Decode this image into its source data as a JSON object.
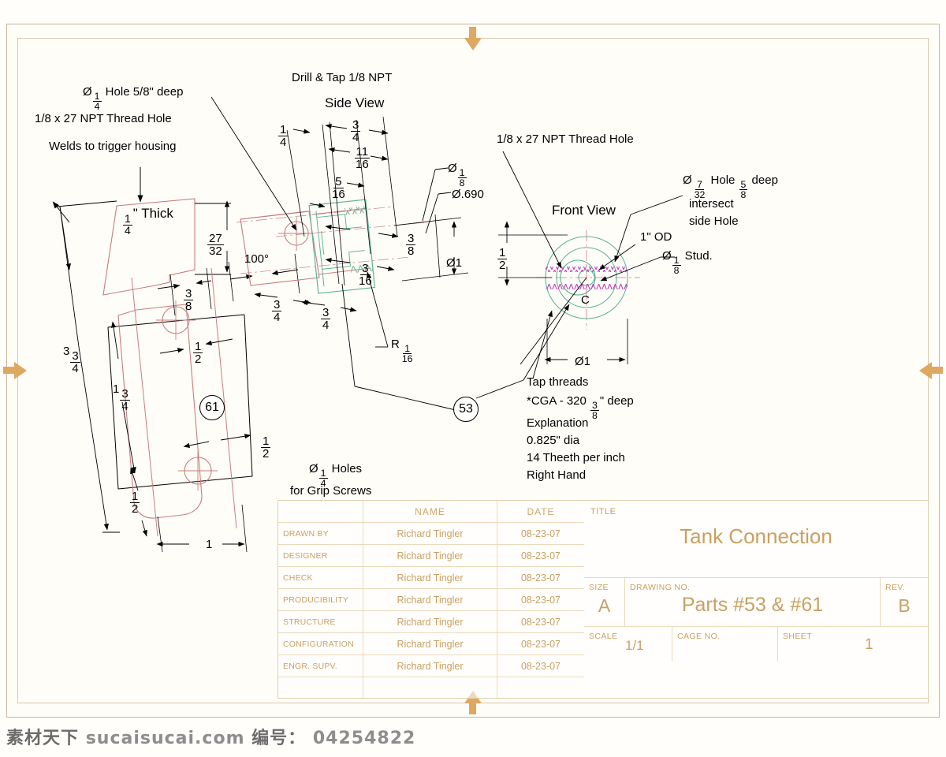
{
  "sheet": {
    "background": "#fffefb",
    "frame_color": "#c8b79a"
  },
  "views": {
    "side_view_label": "Side View",
    "front_view_label": "Front View"
  },
  "notes": {
    "drill_tap": "Drill & Tap 1/8 NPT",
    "hole_deep_prefix": "Ø",
    "hole_deep_num": "1",
    "hole_deep_den": "4",
    "hole_deep_suffix": " Hole 5/8\" deep",
    "npt_thread_hole_left": "1/8 x 27 NPT Thread Hole",
    "welds": "Welds to trigger housing",
    "npt_thread_hole_right": "1/8 x 27 NPT Thread Hole",
    "thick_num": "1",
    "thick_den": "4",
    "thick_suffix": "\" Thick",
    "angle_100": "100°",
    "dia_690": "Ø.690",
    "one_inch_od": "1\" OD",
    "stud_prefix": "Ø",
    "stud_num": "1",
    "stud_den": "8",
    "stud_suffix": " Stud.",
    "hole732_prefix": "Ø",
    "hole732_num": "7",
    "hole732_den": "32",
    "hole732_mid": " Hole ",
    "hole732_num2": "5",
    "hole732_den2": "8",
    "hole732_suffix": " deep",
    "intersect": "intersect",
    "side_hole": "side Hole",
    "center_mark": "C",
    "tap_threads": "Tap threads",
    "cga_pre": "*CGA - 320 ",
    "cga_num": "3",
    "cga_den": "8",
    "cga_post": "\" deep",
    "explanation": "Explanation",
    "dia_0825": "0.825\" dia",
    "teeth": "14 Theeth per inch",
    "right_hand": "Right Hand",
    "grip_prefix": "Ø",
    "grip_num": "1",
    "grip_den": "4",
    "grip_suffix": " Holes",
    "grip_line2": "for Grip Screws",
    "radius_prefix": "R",
    "radius_num": "1",
    "radius_den": "16"
  },
  "dimensions": {
    "d_1_4": {
      "num": "1",
      "den": "4"
    },
    "d_3_4_top": {
      "num": "3",
      "den": "4"
    },
    "d_11_16": {
      "num": "11",
      "den": "16"
    },
    "d_5_16": {
      "num": "5",
      "den": "16"
    },
    "d_3_8_side": {
      "num": "3",
      "den": "8"
    },
    "d_3_16": {
      "num": "3",
      "den": "16"
    },
    "d_3_4_a": {
      "num": "3",
      "den": "4"
    },
    "d_3_4_b": {
      "num": "3",
      "den": "4"
    },
    "d_27_32": {
      "num": "27",
      "den": "32"
    },
    "d_3_8_left": {
      "num": "3",
      "den": "8"
    },
    "d_dia_1_8": {
      "prefix": "Ø",
      "num": "1",
      "den": "8"
    },
    "d_dia_1": "Ø1",
    "d_dia_1_front": "Ø1",
    "d_1_2_front": {
      "num": "1",
      "den": "2"
    },
    "d_3_3_4": {
      "whole": "3",
      "num": "3",
      "den": "4"
    },
    "d_1_3_4": {
      "whole": "1",
      "num": "3",
      "den": "4"
    },
    "d_1_2_a": {
      "num": "1",
      "den": "2"
    },
    "d_1_2_b": {
      "num": "1",
      "den": "2"
    },
    "d_1_2_c": {
      "num": "1",
      "den": "2"
    },
    "d_1": "1"
  },
  "balloons": {
    "part_61": "61",
    "part_53": "53"
  },
  "titleblock": {
    "headers": {
      "name": "NAME",
      "date": "DATE"
    },
    "rows": [
      {
        "label": "DRAWN BY",
        "name": "Richard Tingler",
        "date": "08-23-07"
      },
      {
        "label": "DESIGNER",
        "name": "Richard Tingler",
        "date": "08-23-07"
      },
      {
        "label": "CHECK",
        "name": "Richard Tingler",
        "date": "08-23-07"
      },
      {
        "label": "PRODUCIBILITY",
        "name": "Richard Tingler",
        "date": "08-23-07"
      },
      {
        "label": "STRUCTURE",
        "name": "Richard Tingler",
        "date": "08-23-07"
      },
      {
        "label": "CONFIGURATION",
        "name": "Richard Tingler",
        "date": "08-23-07"
      },
      {
        "label": "ENGR. SUPV.",
        "name": "Richard Tingler",
        "date": "08-23-07"
      }
    ],
    "title_label": "TITLE",
    "title_value": "Tank Connection",
    "size_label": "SIZE",
    "size_value": "A",
    "drawing_no_label": "DRAWING NO.",
    "drawing_no_value": "Parts #53 & #61",
    "rev_label": "REV.",
    "rev_value": "B",
    "scale_label": "SCALE",
    "scale_value": "1/1",
    "cage_label": "CAGE NO.",
    "cage_value": "",
    "sheet_label": "SHEET",
    "sheet_value": "1",
    "text_color": "#c9a063"
  },
  "watermark": {
    "cn": "素材天下",
    "site": "sucaisucai.com",
    "id_label": "编号：",
    "id_value": "04254822"
  },
  "colors": {
    "geometry_red": "#c87d7d",
    "geometry_green": "#5fb39a",
    "geometry_magenta": "#c040c0",
    "dimension_black": "#000000",
    "frame_tan": "#c8b79a",
    "arrow_orange": "#dfa860"
  }
}
